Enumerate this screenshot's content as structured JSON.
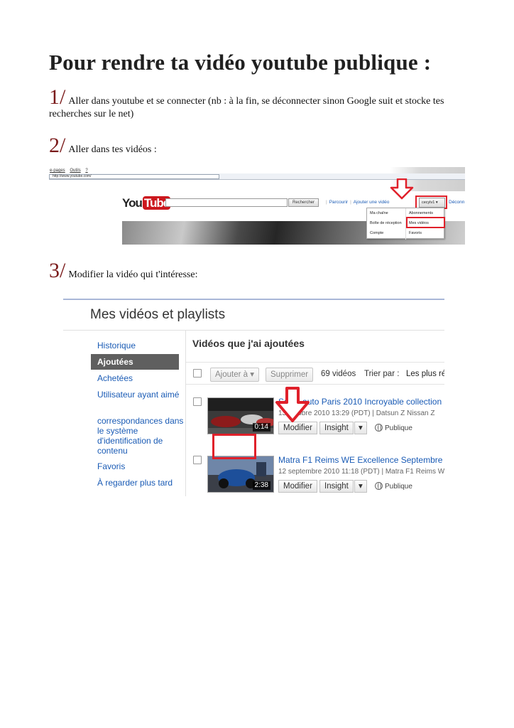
{
  "document": {
    "title": "Pour rendre ta vidéo youtube publique :",
    "steps": [
      {
        "number": "1/",
        "text": "Aller dans youtube et se connecter (nb : à la fin, se déconnecter sinon Google suit et stocke tes recherches sur le net)"
      },
      {
        "number": "2/",
        "text": "Aller dans tes vidéos :"
      },
      {
        "number": "3/",
        "text": "Modifier la vidéo qui t'intéresse:"
      }
    ]
  },
  "youtube_header": {
    "browser_menu": [
      "e-pages",
      "Outils",
      "?"
    ],
    "address_url": "http://www.youtube.com/",
    "logo_you": "You",
    "logo_tube": "Tube",
    "search_button": "Rechercher",
    "links": [
      "Parcourir",
      "Ajouter une vidéo"
    ],
    "username": "cecylv1",
    "logout": "Déconn",
    "dropdown_left": [
      "Ma chaîne",
      "Boîte de réception",
      "Compte"
    ],
    "dropdown_right": [
      "Abonnements",
      "Mes vidéos",
      "Favoris"
    ]
  },
  "my_videos": {
    "page_title": "Mes vidéos et playlists",
    "sidebar": [
      "Historique",
      "Ajoutées",
      "Achetées",
      "Utilisateur ayant aimé",
      "correspondances dans le système d'identification de contenu",
      "Favoris",
      "À regarder plus tard"
    ],
    "section_title": "Vidéos que j'ai ajoutées",
    "toolbar": {
      "add_to": "Ajouter à",
      "delete": "Supprimer",
      "count": "69 vidéos",
      "sort_label": "Trier par :",
      "sort_value": "Les plus ré"
    },
    "videos": [
      {
        "title": "Salon auto Paris 2010 Incroyable collection",
        "date": "13 octobre 2010 13:29 (PDT)",
        "tags": "Datsun Z Nissan Z",
        "duration": "0:14",
        "edit": "Modifier",
        "insight": "Insight",
        "privacy": "Publique"
      },
      {
        "title": "Matra F1 Reims WE Excellence Septembre",
        "date": "12 septembre 2010 11:18 (PDT)",
        "tags": "Matra F1 Reims WE",
        "duration": "2:38",
        "edit": "Modifier",
        "insight": "Insight",
        "privacy": "Publique"
      }
    ]
  },
  "colors": {
    "highlight": "#e0202a",
    "step_number": "#7a1a1a",
    "link": "#1a5bb5"
  }
}
